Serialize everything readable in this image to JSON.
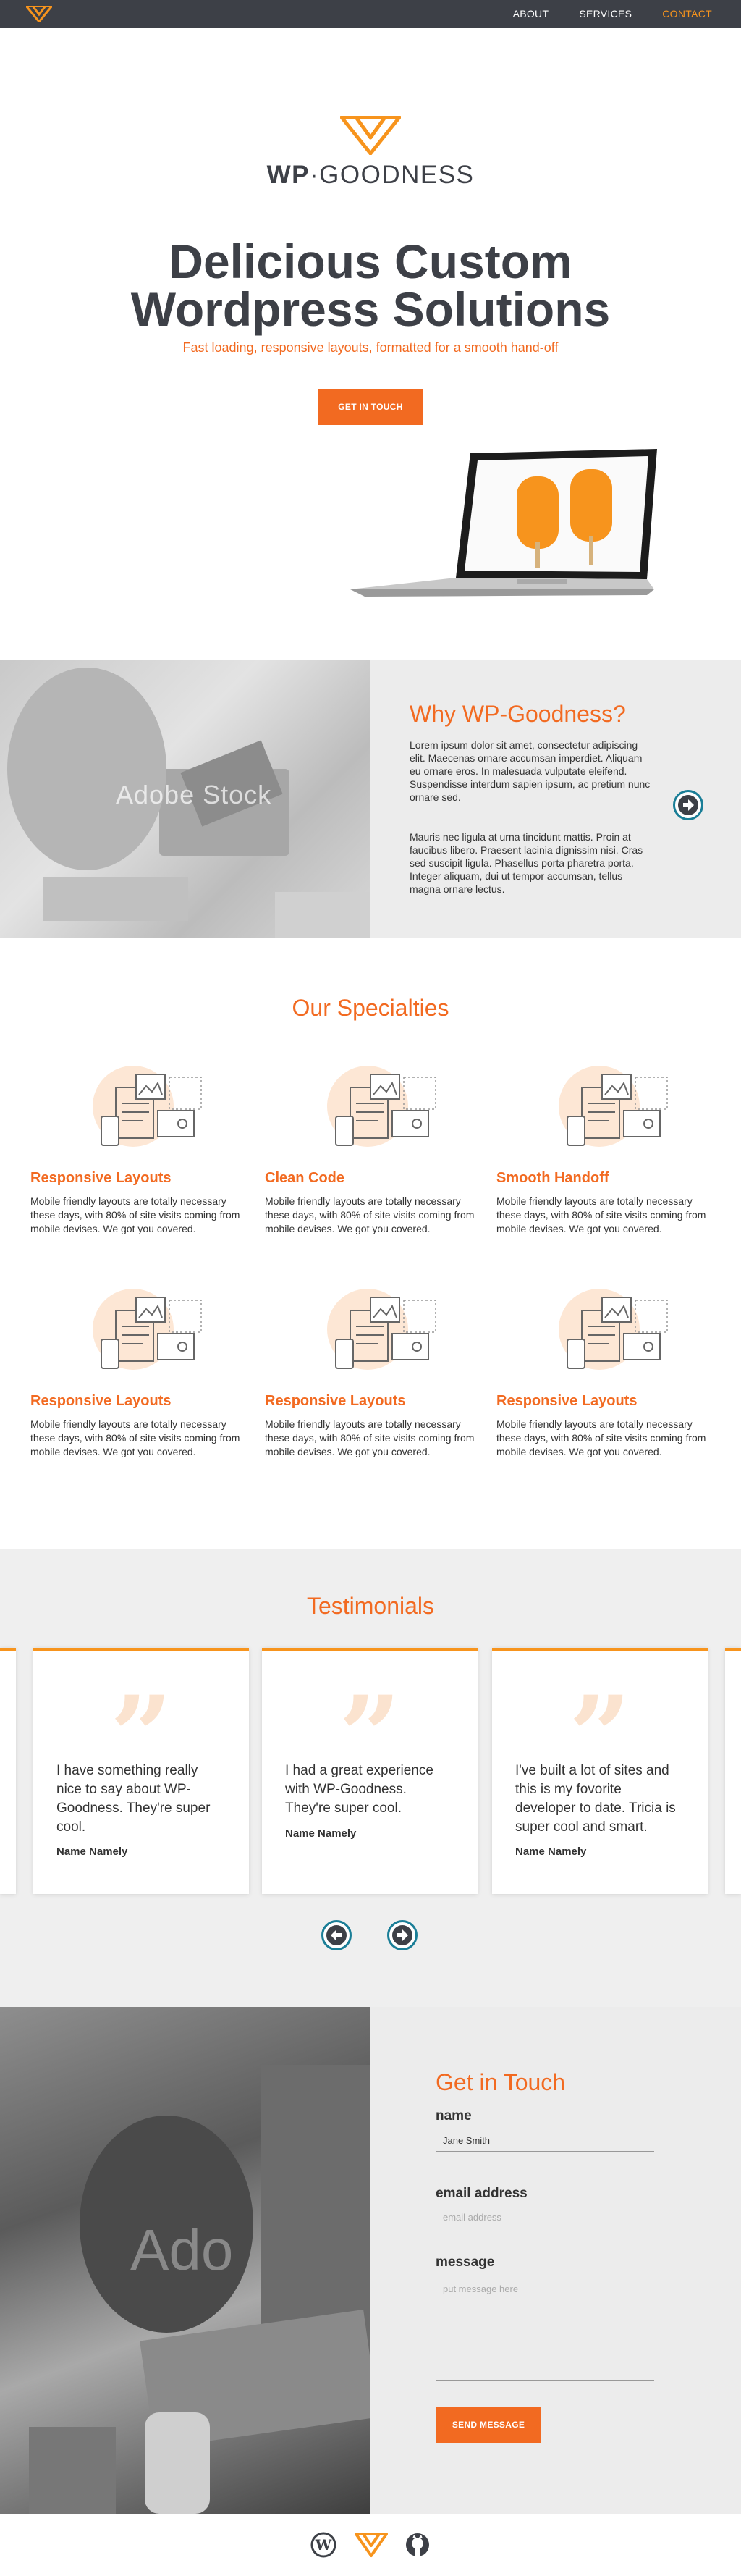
{
  "nav": {
    "items": [
      {
        "label": "ABOUT"
      },
      {
        "label": "SERVICES"
      },
      {
        "label": "CONTACT"
      }
    ],
    "active": "CONTACT"
  },
  "hero": {
    "brand_bold": "WP",
    "brand_sep": "·",
    "brand_rest": "GOODNESS",
    "title_line1": "Delicious Custom",
    "title_line2": "Wordpress Solutions",
    "subtitle": "Fast loading, responsive layouts, formatted for a smooth hand-off",
    "cta_label": "GET IN TOUCH"
  },
  "why": {
    "title": "Why WP-Goodness?",
    "para1": "Lorem ipsum dolor sit amet, consectetur adipiscing elit. Maecenas ornare accumsan imperdiet. Aliquam eu ornare eros. In malesuada vulputate eleifend. Suspendisse interdum sapien ipsum, ac pretium nunc ornare sed.",
    "para2": "Mauris nec ligula at urna tincidunt mattis. Proin at faucibus libero. Praesent lacinia dignissim nisi. Cras sed suscipit ligula. Phasellus porta pharetra porta. Integer aliquam, dui ut tempor accumsan, tellus magna ornare lectus.",
    "watermark": "Adobe Stock"
  },
  "specialties": {
    "title": "Our Specialties",
    "items": [
      {
        "name": "Responsive Layouts",
        "desc": "Mobile friendly layouts are totally necessary these days, with 80% of site visits coming from mobile devises. We got you covered."
      },
      {
        "name": "Clean Code",
        "desc": "Mobile friendly layouts are totally necessary these days, with 80% of site visits coming from mobile devises. We got you covered."
      },
      {
        "name": "Smooth Handoff",
        "desc": "Mobile friendly layouts are totally necessary these days, with 80% of site visits coming from mobile devises. We got you covered."
      },
      {
        "name": "Responsive Layouts",
        "desc": "Mobile friendly layouts are totally necessary these days, with 80% of site visits coming from mobile devises. We got you covered."
      },
      {
        "name": "Responsive Layouts",
        "desc": "Mobile friendly layouts are totally necessary these days, with 80% of site visits coming from mobile devises. We got you covered."
      },
      {
        "name": "Responsive Layouts",
        "desc": "Mobile friendly layouts are totally necessary these days, with 80% of site visits coming from mobile devises. We got you covered."
      }
    ]
  },
  "testimonials": {
    "title": "Testimonials",
    "items": [
      {
        "text": "I have something really nice to say about WP-Goodness. They're super cool.",
        "name": "Name Namely"
      },
      {
        "text": "I had a great experience with WP-Goodness. They're super cool.",
        "name": "Name Namely"
      },
      {
        "text": "I've built a lot of sites and this is my fovorite developer to date. Tricia is super cool and smart.",
        "name": "Name Namely"
      }
    ]
  },
  "contact": {
    "title": "Get in Touch",
    "name_label": "name",
    "name_value": "Jane Smith",
    "email_label": "email address",
    "email_placeholder": "email address",
    "message_label": "message",
    "message_placeholder": "put message here",
    "submit_label": "SEND MESSAGE",
    "watermark": "Ado"
  },
  "colors": {
    "accent": "#f26a21",
    "accent_light": "#f7941d",
    "nav_bg": "#3d4047",
    "arrow_ring": "#1a7e97"
  },
  "footer": {
    "icons": [
      "wordpress-icon",
      "wp-goodness-logo-icon",
      "github-icon"
    ]
  }
}
